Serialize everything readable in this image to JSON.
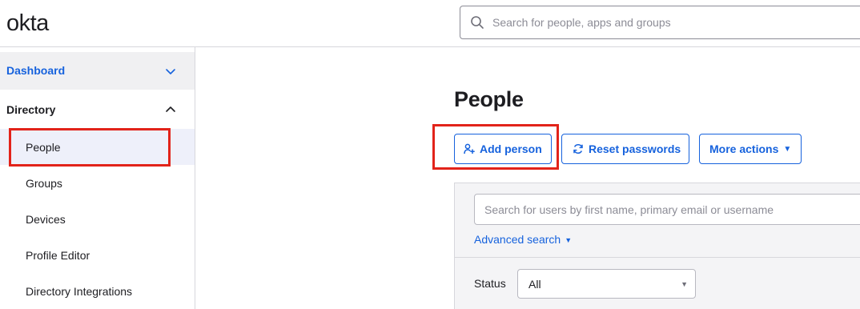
{
  "header": {
    "logo_text": "okta",
    "search": {
      "placeholder": "Search for people, apps and groups",
      "value": "",
      "icon": "search-icon"
    }
  },
  "sidebar": {
    "dashboard": {
      "label": "Dashboard",
      "expanded": false,
      "icon": "chevron-down-icon",
      "color": "#1662dd"
    },
    "directory": {
      "label": "Directory",
      "expanded": true,
      "icon": "chevron-up-icon",
      "items": [
        {
          "label": "People",
          "active": true
        },
        {
          "label": "Groups",
          "active": false
        },
        {
          "label": "Devices",
          "active": false
        },
        {
          "label": "Profile Editor",
          "active": false
        },
        {
          "label": "Directory Integrations",
          "active": false
        }
      ]
    }
  },
  "main": {
    "title": "People",
    "actions": {
      "add_person": {
        "label": "Add person",
        "icon": "add-user-icon"
      },
      "reset_passwords": {
        "label": "Reset passwords",
        "icon": "refresh-icon"
      },
      "more_actions": {
        "label": "More actions",
        "icon": "caret-down-icon"
      }
    },
    "filter": {
      "search_placeholder": "Search for users by first name, primary email or username",
      "search_value": "",
      "advanced_search_label": "Advanced search",
      "status_label": "Status",
      "status_value": "All"
    }
  },
  "annotations": {
    "highlight_color": "#e2231a"
  },
  "colors": {
    "accent": "#1662dd",
    "text": "#1d1d21",
    "border": "#d7d7dc"
  }
}
